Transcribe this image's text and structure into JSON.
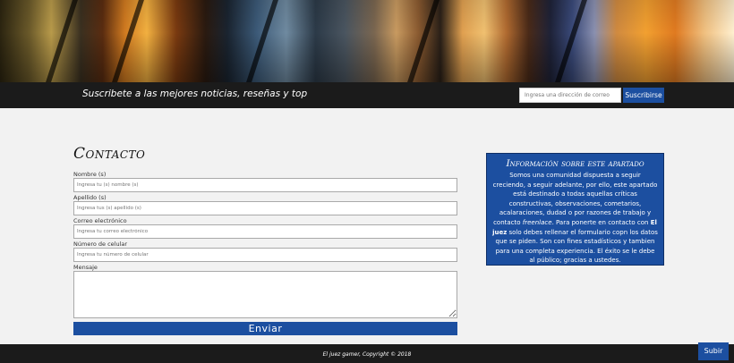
{
  "header": {
    "tagline": "Suscribete a las mejores noticias, reseñas y top",
    "email_placeholder": "Ingresa una dirección de correo",
    "subscribe_label": "Suscribirse"
  },
  "contact": {
    "title": "Contacto",
    "fields": [
      {
        "label": "Nombre (s)",
        "placeholder": "Ingresa tu (s) nombre (s)"
      },
      {
        "label": "Apellido (s)",
        "placeholder": "Ingresa tus (s) apellido (s)"
      },
      {
        "label": "Correo electrónico",
        "placeholder": "Ingresa tu correo electrónico"
      },
      {
        "label": "Número de celular",
        "placeholder": "Ingresa tu número de celular"
      }
    ],
    "message_label": "Mensaje",
    "submit_label": "Enviar"
  },
  "info": {
    "title": "Información sobre este apartado",
    "text_part1": "Somos una comunidad dispuesta a seguir creciendo, a seguir adelante, por ello, este apartado está destinado a todas aquellas críticas constructivas, observaciones, cometarios, acalaraciones, dudad o por razones de trabajo y contacto ",
    "text_em": "freenlace",
    "text_part2": ". Para ponerte en contacto con ",
    "text_bold": "El juez",
    "text_part3": " solo debes rellenar el formulario copn los datos que se piden. Son con fines estadísticos y tambien para una completa experiencia. El éxito se le debe al público; gracias a ustedes."
  },
  "footer": {
    "copyright": "El juez gamer, Copyright © 2018",
    "top_label": "Subir"
  },
  "colors": {
    "accent": "#1c4fa0",
    "dark_bar": "#1b1b1b",
    "page_bg": "#f2f2f2"
  }
}
